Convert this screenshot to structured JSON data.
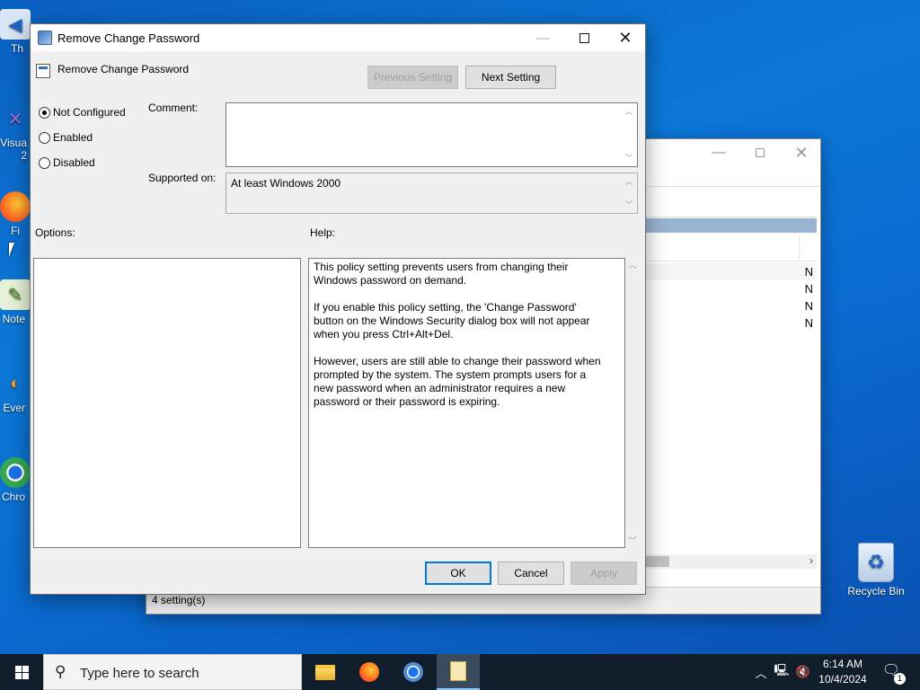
{
  "desktop": {
    "icons": [
      {
        "label": "Th",
        "icon": "app-icon"
      },
      {
        "label": "Visua\n2",
        "icon": "visual-studio-icon"
      },
      {
        "label": "Fi",
        "icon": "firefox-icon"
      },
      {
        "label": "Note",
        "icon": "notepad-plus-plus-icon"
      },
      {
        "label": "Ever",
        "icon": "everything-icon"
      },
      {
        "label": "Chro",
        "icon": "chrome-icon"
      }
    ],
    "recycle_bin": {
      "label": "Recycle Bin",
      "icon": "recycle-bin-icon"
    }
  },
  "background_window": {
    "row_values": [
      "N",
      "N",
      "N",
      "N"
    ],
    "status": "4 setting(s)"
  },
  "dialog": {
    "title": "Remove Change Password",
    "policy_name": "Remove Change Password",
    "prev_button": "Previous Setting",
    "next_button": "Next Setting",
    "radios": [
      {
        "label": "Not Configured",
        "selected": true
      },
      {
        "label": "Enabled",
        "selected": false
      },
      {
        "label": "Disabled",
        "selected": false
      }
    ],
    "comment_label": "Comment:",
    "comment_value": "",
    "supported_label": "Supported on:",
    "supported_value": "At least Windows 2000",
    "options_label": "Options:",
    "help_label": "Help:",
    "help_text": "This policy setting prevents users from changing their Windows password on demand.\n\nIf you enable this policy setting,  the 'Change Password' button on the Windows Security dialog box will not appear when you press Ctrl+Alt+Del.\n\nHowever, users are still able to change their password when prompted by the system. The system prompts users for a new password when an administrator requires a new password or their password is expiring.",
    "ok_button": "OK",
    "cancel_button": "Cancel",
    "apply_button": "Apply"
  },
  "taskbar": {
    "search_placeholder": "Type here to search",
    "apps": [
      "file-explorer-icon",
      "firefox-icon",
      "chrome-icon",
      "notepad-icon"
    ],
    "time": "6:14 AM",
    "date": "10/4/2024",
    "notification_count": "1"
  },
  "colors": {
    "desktop_blue": "#0b78d6",
    "dialog_bg": "#f0f0f0",
    "accent": "#0078d7",
    "taskbar": "#101d2b"
  }
}
